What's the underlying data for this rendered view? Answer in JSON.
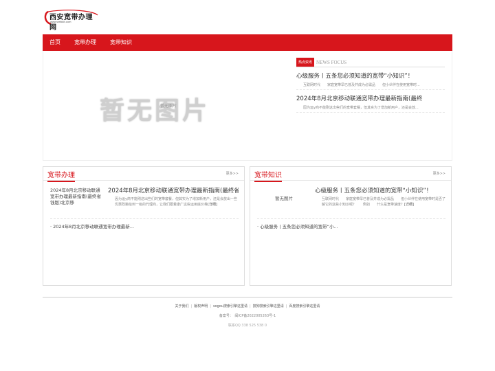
{
  "header": {
    "logo_text": "西安宽带办理网",
    "logo_sub": "www.weikkb.com"
  },
  "nav": {
    "items": [
      {
        "label": "首页"
      },
      {
        "label": "宽带办理"
      },
      {
        "label": "宽带知识"
      }
    ]
  },
  "banner": {
    "noimage_big": "暂无图片",
    "noimage_small": "暂无图片",
    "focus": {
      "badge": "热点资讯",
      "en": "NEWS FOCUS",
      "articles": [
        {
          "title": "心级服务丨五条您必须知道的宽带“小知识”！",
          "desc": "互联网时代　　家庭宽带早已普及并成为必需品　　但小伙伴在使用宽带时..."
        },
        {
          "title": "2024年8月北京移动联通宽带办理最新指南(最终",
          "desc": "因为运y商不能刚这出些们的宽带套餐，但其实为了增加新用户，还是会放..."
        }
      ]
    }
  },
  "left_box": {
    "title": "宽带办理",
    "more": "更多>>",
    "thumb": "2024年8月北京移动联通宽带办理最新指南(最终省钱版)北京移",
    "article_title": "2024年8月北京移动联通宽带办理最新指南(最终省...",
    "article_desc": "因为运y商不能刚这出些们的宽带套餐，但其实为了增加新用户，还是会放出一些优惠政策给到一级的代理商，让我们跟着康广这些运用底价券",
    "detail": "[详细]",
    "list": [
      "· 2024年8月北京移动联通宽带办理最新..."
    ]
  },
  "right_box": {
    "title": "宽带知识",
    "more": "更多>>",
    "thumb": "暂无图片",
    "article_title": "心级服务丨五条您必须知道的宽带“小知识”！",
    "article_desc": "互联网时代　　家庭宽带早已普及并成为必需品　　但小伙伴在使用宽带时是否了解它的这些小知识呢？　　例如　　什么是宽带速度？",
    "detail": "[详细]",
    "list": [
      "· 心级服务丨五条您必须知道的宽带“小..."
    ]
  },
  "footer": {
    "links": [
      "关于我们",
      "版权声明",
      "sogou搜索引擎这里请",
      "搜狗搜索引擎这里请",
      "百度搜索引擎这里请"
    ],
    "icp": "备案号：　闽ICP备2022005263号-1",
    "contact": "联系QQ 338 525 538 0"
  },
  "colors": {
    "brand_red": "#d7161c",
    "muted_text": "#888888"
  },
  "icons": {
    "logo": "broadband-logo-swoosh"
  }
}
